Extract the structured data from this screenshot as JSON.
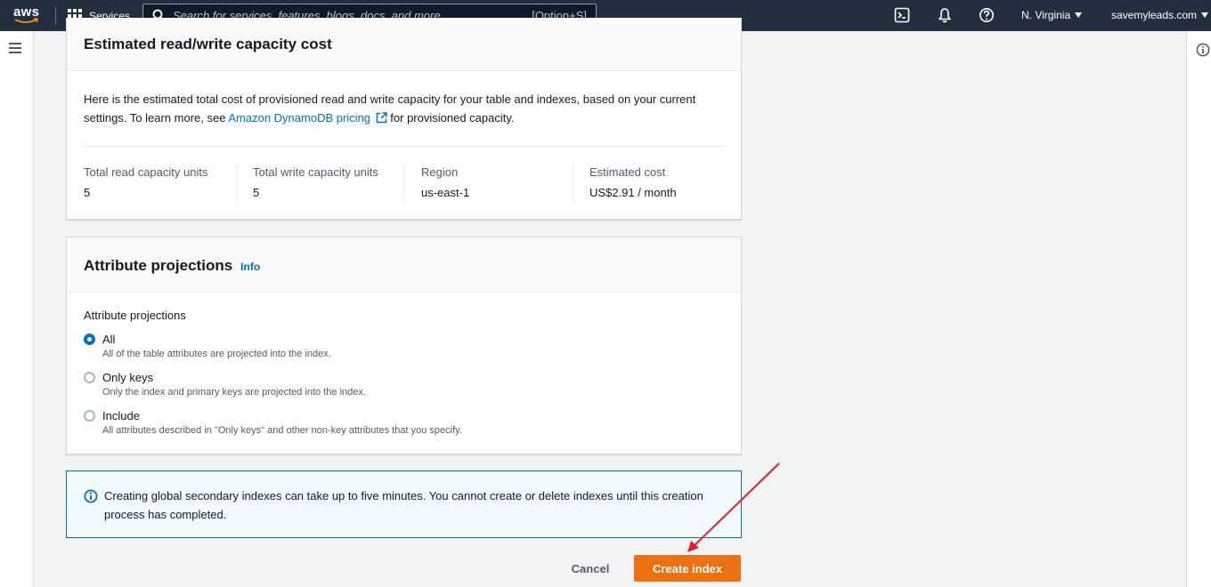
{
  "topnav": {
    "logo_text": "aws",
    "services_label": "Services",
    "search_placeholder": "Search for services, features, blogs, docs, and more",
    "search_shortcut": "[Option+S]",
    "region": "N. Virginia",
    "account": "savemyleads.com",
    "icons": [
      "cloudshell-icon",
      "notifications-bell-icon",
      "help-icon"
    ]
  },
  "cost_panel": {
    "title": "Estimated read/write capacity cost",
    "description_pre": "Here is the estimated total cost of provisioned read and write capacity for your table and indexes, based on your current settings. To learn more, see ",
    "pricing_link": "Amazon DynamoDB pricing",
    "description_post": " for provisioned capacity.",
    "fields": [
      {
        "label": "Total read capacity units",
        "value": "5"
      },
      {
        "label": "Total write capacity units",
        "value": "5"
      },
      {
        "label": "Region",
        "value": "us-east-1"
      },
      {
        "label": "Estimated cost",
        "value": "US$2.91 / month"
      }
    ]
  },
  "projections_panel": {
    "title": "Attribute projections",
    "info_link": "Info",
    "field_label": "Attribute projections",
    "options": [
      {
        "label": "All",
        "description": "All of the table attributes are projected into the index.",
        "selected": true
      },
      {
        "label": "Only keys",
        "description": "Only the index and primary keys are projected into the index.",
        "selected": false
      },
      {
        "label": "Include",
        "description": "All attributes described in \"Only keys\" and other non-key attributes that you specify.",
        "selected": false
      }
    ]
  },
  "alert": {
    "text": "Creating global secondary indexes can take up to five minutes. You cannot create or delete indexes until this creation process has completed."
  },
  "actions": {
    "cancel_label": "Cancel",
    "create_label": "Create index"
  },
  "colors": {
    "nav_bg": "#232f3e",
    "primary_button": "#ec7211",
    "link": "#0073bb",
    "annotation_arrow": "#e8202a"
  }
}
